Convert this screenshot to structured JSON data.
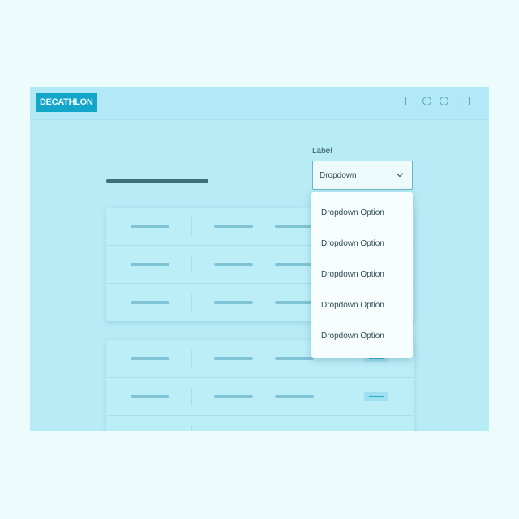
{
  "header": {
    "logo_text": "DECATHLON",
    "icons": [
      "store-icon",
      "user-icon",
      "help-icon",
      "cart-icon"
    ]
  },
  "form": {
    "label": "Label",
    "select_value": "Dropdown",
    "options": [
      "Dropdown Option",
      "Dropdown Option",
      "Dropdown Option",
      "Dropdown Option",
      "Dropdown Option"
    ]
  },
  "colors": {
    "page_bg": "#ecfcfd",
    "frame_bg": "#b7ebf6",
    "brand": "#13a6c9"
  }
}
